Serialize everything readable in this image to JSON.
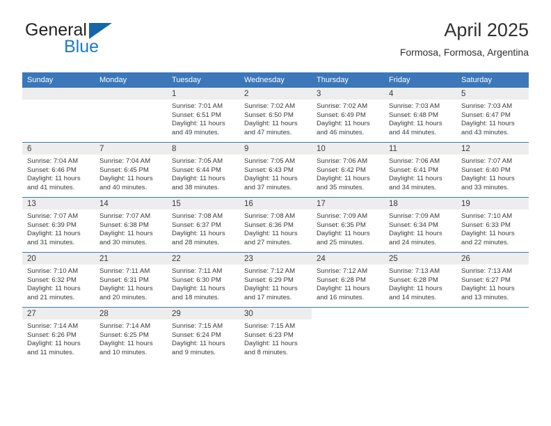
{
  "brand": {
    "name_top": "General",
    "name_bottom": "Blue",
    "accent_color": "#1a7ac4",
    "triangle_color": "#1565a8"
  },
  "header": {
    "title": "April 2025",
    "subtitle": "Formosa, Formosa, Argentina"
  },
  "theme": {
    "header_blue": "#3b77b9",
    "daynum_band": "#ededed",
    "text": "#3a3a3a"
  },
  "weekday_headers": [
    "Sunday",
    "Monday",
    "Tuesday",
    "Wednesday",
    "Thursday",
    "Friday",
    "Saturday"
  ],
  "weeks": [
    [
      {
        "day": "",
        "empty": true
      },
      {
        "day": "",
        "empty": true
      },
      {
        "day": "1",
        "sunrise": "Sunrise: 7:01 AM",
        "sunset": "Sunset: 6:51 PM",
        "daylight1": "Daylight: 11 hours",
        "daylight2": "and 49 minutes."
      },
      {
        "day": "2",
        "sunrise": "Sunrise: 7:02 AM",
        "sunset": "Sunset: 6:50 PM",
        "daylight1": "Daylight: 11 hours",
        "daylight2": "and 47 minutes."
      },
      {
        "day": "3",
        "sunrise": "Sunrise: 7:02 AM",
        "sunset": "Sunset: 6:49 PM",
        "daylight1": "Daylight: 11 hours",
        "daylight2": "and 46 minutes."
      },
      {
        "day": "4",
        "sunrise": "Sunrise: 7:03 AM",
        "sunset": "Sunset: 6:48 PM",
        "daylight1": "Daylight: 11 hours",
        "daylight2": "and 44 minutes."
      },
      {
        "day": "5",
        "sunrise": "Sunrise: 7:03 AM",
        "sunset": "Sunset: 6:47 PM",
        "daylight1": "Daylight: 11 hours",
        "daylight2": "and 43 minutes."
      }
    ],
    [
      {
        "day": "6",
        "sunrise": "Sunrise: 7:04 AM",
        "sunset": "Sunset: 6:46 PM",
        "daylight1": "Daylight: 11 hours",
        "daylight2": "and 41 minutes."
      },
      {
        "day": "7",
        "sunrise": "Sunrise: 7:04 AM",
        "sunset": "Sunset: 6:45 PM",
        "daylight1": "Daylight: 11 hours",
        "daylight2": "and 40 minutes."
      },
      {
        "day": "8",
        "sunrise": "Sunrise: 7:05 AM",
        "sunset": "Sunset: 6:44 PM",
        "daylight1": "Daylight: 11 hours",
        "daylight2": "and 38 minutes."
      },
      {
        "day": "9",
        "sunrise": "Sunrise: 7:05 AM",
        "sunset": "Sunset: 6:43 PM",
        "daylight1": "Daylight: 11 hours",
        "daylight2": "and 37 minutes."
      },
      {
        "day": "10",
        "sunrise": "Sunrise: 7:06 AM",
        "sunset": "Sunset: 6:42 PM",
        "daylight1": "Daylight: 11 hours",
        "daylight2": "and 35 minutes."
      },
      {
        "day": "11",
        "sunrise": "Sunrise: 7:06 AM",
        "sunset": "Sunset: 6:41 PM",
        "daylight1": "Daylight: 11 hours",
        "daylight2": "and 34 minutes."
      },
      {
        "day": "12",
        "sunrise": "Sunrise: 7:07 AM",
        "sunset": "Sunset: 6:40 PM",
        "daylight1": "Daylight: 11 hours",
        "daylight2": "and 33 minutes."
      }
    ],
    [
      {
        "day": "13",
        "sunrise": "Sunrise: 7:07 AM",
        "sunset": "Sunset: 6:39 PM",
        "daylight1": "Daylight: 11 hours",
        "daylight2": "and 31 minutes."
      },
      {
        "day": "14",
        "sunrise": "Sunrise: 7:07 AM",
        "sunset": "Sunset: 6:38 PM",
        "daylight1": "Daylight: 11 hours",
        "daylight2": "and 30 minutes."
      },
      {
        "day": "15",
        "sunrise": "Sunrise: 7:08 AM",
        "sunset": "Sunset: 6:37 PM",
        "daylight1": "Daylight: 11 hours",
        "daylight2": "and 28 minutes."
      },
      {
        "day": "16",
        "sunrise": "Sunrise: 7:08 AM",
        "sunset": "Sunset: 6:36 PM",
        "daylight1": "Daylight: 11 hours",
        "daylight2": "and 27 minutes."
      },
      {
        "day": "17",
        "sunrise": "Sunrise: 7:09 AM",
        "sunset": "Sunset: 6:35 PM",
        "daylight1": "Daylight: 11 hours",
        "daylight2": "and 25 minutes."
      },
      {
        "day": "18",
        "sunrise": "Sunrise: 7:09 AM",
        "sunset": "Sunset: 6:34 PM",
        "daylight1": "Daylight: 11 hours",
        "daylight2": "and 24 minutes."
      },
      {
        "day": "19",
        "sunrise": "Sunrise: 7:10 AM",
        "sunset": "Sunset: 6:33 PM",
        "daylight1": "Daylight: 11 hours",
        "daylight2": "and 22 minutes."
      }
    ],
    [
      {
        "day": "20",
        "sunrise": "Sunrise: 7:10 AM",
        "sunset": "Sunset: 6:32 PM",
        "daylight1": "Daylight: 11 hours",
        "daylight2": "and 21 minutes."
      },
      {
        "day": "21",
        "sunrise": "Sunrise: 7:11 AM",
        "sunset": "Sunset: 6:31 PM",
        "daylight1": "Daylight: 11 hours",
        "daylight2": "and 20 minutes."
      },
      {
        "day": "22",
        "sunrise": "Sunrise: 7:11 AM",
        "sunset": "Sunset: 6:30 PM",
        "daylight1": "Daylight: 11 hours",
        "daylight2": "and 18 minutes."
      },
      {
        "day": "23",
        "sunrise": "Sunrise: 7:12 AM",
        "sunset": "Sunset: 6:29 PM",
        "daylight1": "Daylight: 11 hours",
        "daylight2": "and 17 minutes."
      },
      {
        "day": "24",
        "sunrise": "Sunrise: 7:12 AM",
        "sunset": "Sunset: 6:28 PM",
        "daylight1": "Daylight: 11 hours",
        "daylight2": "and 16 minutes."
      },
      {
        "day": "25",
        "sunrise": "Sunrise: 7:13 AM",
        "sunset": "Sunset: 6:28 PM",
        "daylight1": "Daylight: 11 hours",
        "daylight2": "and 14 minutes."
      },
      {
        "day": "26",
        "sunrise": "Sunrise: 7:13 AM",
        "sunset": "Sunset: 6:27 PM",
        "daylight1": "Daylight: 11 hours",
        "daylight2": "and 13 minutes."
      }
    ],
    [
      {
        "day": "27",
        "sunrise": "Sunrise: 7:14 AM",
        "sunset": "Sunset: 6:26 PM",
        "daylight1": "Daylight: 11 hours",
        "daylight2": "and 11 minutes."
      },
      {
        "day": "28",
        "sunrise": "Sunrise: 7:14 AM",
        "sunset": "Sunset: 6:25 PM",
        "daylight1": "Daylight: 11 hours",
        "daylight2": "and 10 minutes."
      },
      {
        "day": "29",
        "sunrise": "Sunrise: 7:15 AM",
        "sunset": "Sunset: 6:24 PM",
        "daylight1": "Daylight: 11 hours",
        "daylight2": "and 9 minutes."
      },
      {
        "day": "30",
        "sunrise": "Sunrise: 7:15 AM",
        "sunset": "Sunset: 6:23 PM",
        "daylight1": "Daylight: 11 hours",
        "daylight2": "and 8 minutes."
      },
      {
        "day": "",
        "empty": true,
        "no_band": true
      },
      {
        "day": "",
        "empty": true,
        "no_band": true
      },
      {
        "day": "",
        "empty": true,
        "no_band": true
      }
    ]
  ]
}
